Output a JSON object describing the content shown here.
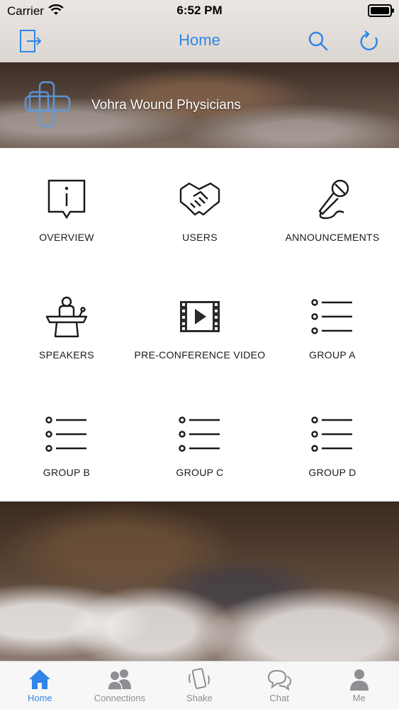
{
  "status_bar": {
    "carrier": "Carrier",
    "time": "6:52 PM"
  },
  "nav": {
    "title": "Home",
    "accent": "#2f86e6",
    "left_icon": "logout-icon",
    "right_icons": [
      "search-icon",
      "refresh-icon"
    ]
  },
  "banner": {
    "title": "Vohra Wound Physicians",
    "logo_icon": "medical-cross-logo"
  },
  "grid": {
    "items": [
      {
        "label": "OVERVIEW",
        "icon": "info-icon"
      },
      {
        "label": "USERS",
        "icon": "handshake-icon"
      },
      {
        "label": "ANNOUNCEMENTS",
        "icon": "microphone-icon"
      },
      {
        "label": "SPEAKERS",
        "icon": "speaker-podium-icon"
      },
      {
        "label": "PRE-CONFERENCE VIDEO",
        "icon": "video-play-icon"
      },
      {
        "label": "GROUP A",
        "icon": "list-icon"
      },
      {
        "label": "GROUP B",
        "icon": "list-icon"
      },
      {
        "label": "GROUP C",
        "icon": "list-icon"
      },
      {
        "label": "GROUP D",
        "icon": "list-icon"
      }
    ]
  },
  "tab_bar": {
    "active_color": "#2f86e6",
    "inactive_color": "#8e8e93",
    "items": [
      {
        "label": "Home",
        "icon": "home-icon",
        "active": true
      },
      {
        "label": "Connections",
        "icon": "people-icon",
        "active": false
      },
      {
        "label": "Shake",
        "icon": "shake-phone-icon",
        "active": false
      },
      {
        "label": "Chat",
        "icon": "chat-bubbles-icon",
        "active": false
      },
      {
        "label": "Me",
        "icon": "person-icon",
        "active": false
      }
    ]
  }
}
